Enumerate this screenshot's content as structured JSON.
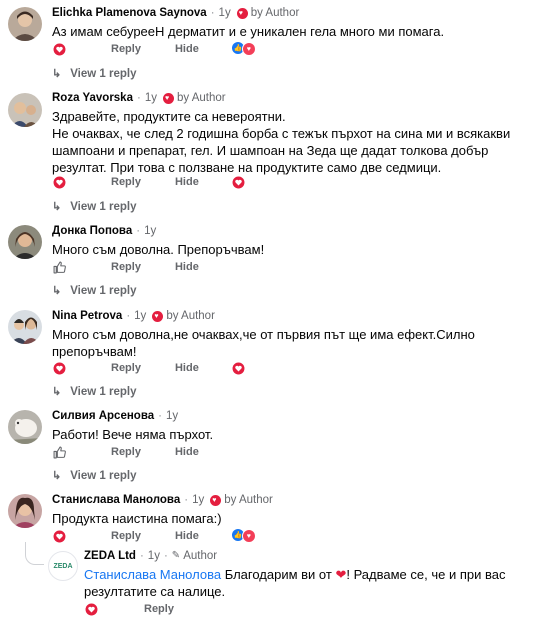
{
  "colors": {
    "heart": "#e41e3f",
    "link": "#1877f2",
    "muted": "#65676b",
    "like": "#1877f2",
    "love": "#f33e58"
  },
  "labels": {
    "reply": "Reply",
    "hide": "Hide",
    "view_reply": "View 1 reply",
    "by_author": "by Author",
    "author": "Author"
  },
  "comments": [
    {
      "name": "Elichka Plamenova Saynova",
      "time": "1y",
      "by_author": true,
      "text": "Аз имам себурееН дерматит и е уникален гела много ми помага.",
      "reactions": true
    },
    {
      "name": "Roza Yavorska",
      "time": "1y",
      "by_author": true,
      "text": "Здравейте, продуктите са невероятни.\nНе очаквах, че след 2 годишна борба с тежък пърхот на сина ми и всякакви шампоани и препарат, гел. И шампоан на Зеда ще дадат толкова добър резултат. При това с ползване на продуктите само две седмици.",
      "reactions": false
    },
    {
      "name": "Донка Попова",
      "time": "1y",
      "by_author": false,
      "text": "Много съм доволна. Препоръчвам!",
      "reactions": false
    },
    {
      "name": "Nina Petrova",
      "time": "1y",
      "by_author": true,
      "text": "Много съм доволна,не очаквах,че от първия път ще има ефект.Силно препоръчвам!",
      "reactions": false
    },
    {
      "name": "Силвия Арсенова",
      "time": "1y",
      "by_author": false,
      "text": "Работи! Вече няма пърхот.",
      "reactions": false
    },
    {
      "name": "Станислава Манолова",
      "time": "1y",
      "by_author": true,
      "text": "Продукта наистина помага:)",
      "reactions": true
    }
  ],
  "reply": {
    "name": "ZEDA Ltd",
    "time": "1y",
    "author_label": "Author",
    "mention": "Станислава Манолова",
    "text_before": " Благодарим ви от ",
    "text_after": "! Радваме се, че и при вас резултатите са налице.",
    "avatar_text": "ZEDA"
  }
}
